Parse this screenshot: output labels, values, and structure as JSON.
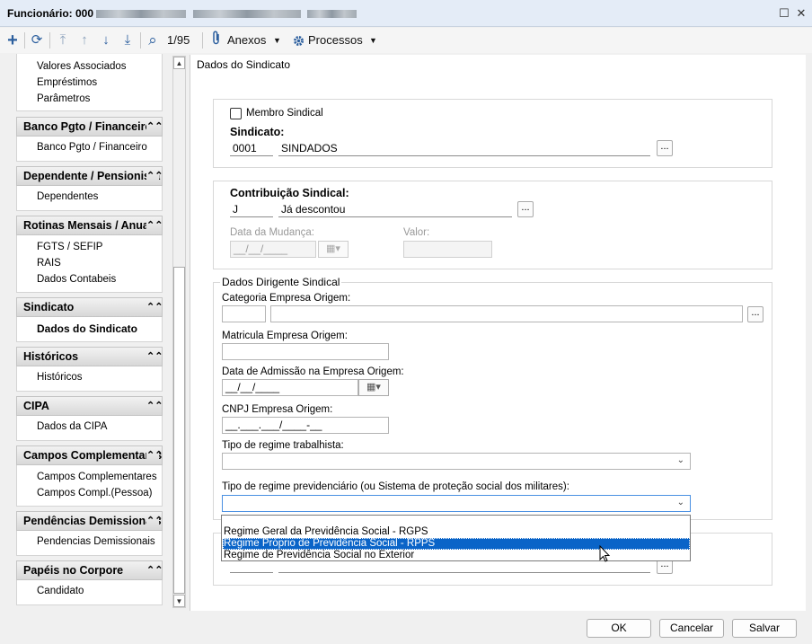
{
  "window": {
    "title_prefix": "Funcionário: 000",
    "maximize_glyph": "☐",
    "close_glyph": "✕"
  },
  "toolbar": {
    "add_glyph": "+",
    "refresh_glyph": "⟳",
    "first_glyph": "⤒",
    "prev_glyph": "↑",
    "next_glyph": "↓",
    "last_glyph": "⤓",
    "search_glyph": "⌕",
    "record_counter": "1/95",
    "attachments_label": "Anexos",
    "processes_label": "Processos",
    "dropdown_glyph": "▼"
  },
  "sidebar": {
    "top_items": [
      "Valores Associados",
      "Empréstimos",
      "Parâmetros"
    ],
    "sections": [
      {
        "header": "Banco Pgto / Financeiro",
        "items": [
          "Banco Pgto / Financeiro"
        ]
      },
      {
        "header": "Dependente / Pensionista",
        "items": [
          "Dependentes"
        ]
      },
      {
        "header": "Rotinas Mensais / Anuais",
        "items": [
          "FGTS / SEFIP",
          "RAIS",
          "Dados Contabeis"
        ]
      },
      {
        "header": "Sindicato",
        "items": [
          "Dados do Sindicato"
        ]
      },
      {
        "header": "Históricos",
        "items": [
          "Históricos"
        ]
      },
      {
        "header": "CIPA",
        "items": [
          "Dados da CIPA"
        ]
      },
      {
        "header": "Campos Complementares",
        "items": [
          "Campos Complementares",
          "Campos Compl.(Pessoa)"
        ]
      },
      {
        "header": "Pendências Demissionais",
        "items": [
          "Pendencias Demissionais"
        ]
      },
      {
        "header": "Papéis no Corpore",
        "items": [
          "Candidato"
        ]
      }
    ],
    "collapse_glyph": "⌃⌃"
  },
  "form": {
    "panel_title": "Dados do Sindicato",
    "membro_sindical_label": "Membro Sindical",
    "sindicato_label": "Sindicato:",
    "sindicato_code": "0001",
    "sindicato_name": "SINDADOS",
    "ellipsis": "...",
    "contribuicao_label": "Contribuição Sindical:",
    "contribuicao_code": "J",
    "contribuicao_desc": "Já descontou",
    "data_mudanca_label": "Data da Mudança:",
    "date_mask": "__/__/____",
    "valor_label": "Valor:",
    "dirigente_title": "Dados Dirigente Sindical",
    "categoria_label": "Categoria Empresa Origem:",
    "matricula_label": "Matricula Empresa Origem:",
    "data_admissao_label": "Data de Admissão na Empresa Origem:",
    "cnpj_label": "CNPJ Empresa Origem:",
    "cnpj_mask": "__.___.___/____-__",
    "tipo_trabalhista_label": "Tipo de regime trabalhista:",
    "tipo_previdenciario_label": "Tipo de regime previdenciário (ou Sistema de proteção social dos militares):",
    "calendar_glyph": "▦▾",
    "select_caret": "⌄"
  },
  "dropdown_options": [
    "",
    "Regime Geral da Previdência Social - RGPS",
    "Regime Próprio de Previdência Social - RPPS",
    "Regime de Previdência Social no Exterior"
  ],
  "dropdown_highlight_index": 2,
  "scroll": {
    "up_glyph": "▲",
    "down_glyph": "▼"
  },
  "buttons": {
    "ok": "OK",
    "cancel": "Cancelar",
    "save": "Salvar"
  }
}
